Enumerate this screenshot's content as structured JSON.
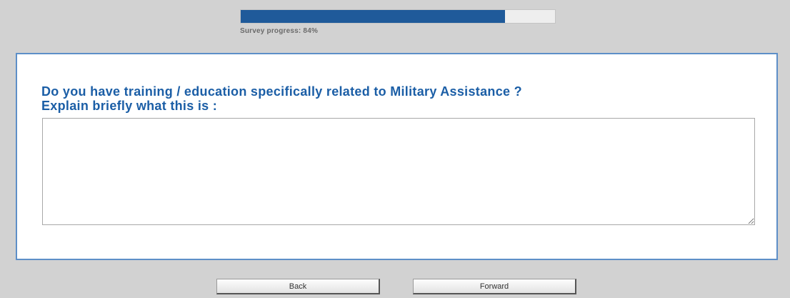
{
  "progress": {
    "label": "Survey progress: 84%",
    "fraction": 0.84
  },
  "question": {
    "line1": "Do you have training / education specifically related to Military Assistance ?",
    "line2": "Explain briefly what this is :"
  },
  "answer": {
    "value": ""
  },
  "nav": {
    "back_label": "Back",
    "forward_label": "Forward"
  },
  "colors": {
    "progress_fill": "#1f5a9a",
    "question_text": "#1b5ea6",
    "panel_border": "#5d8fc8",
    "page_background": "#d2d2d2"
  }
}
